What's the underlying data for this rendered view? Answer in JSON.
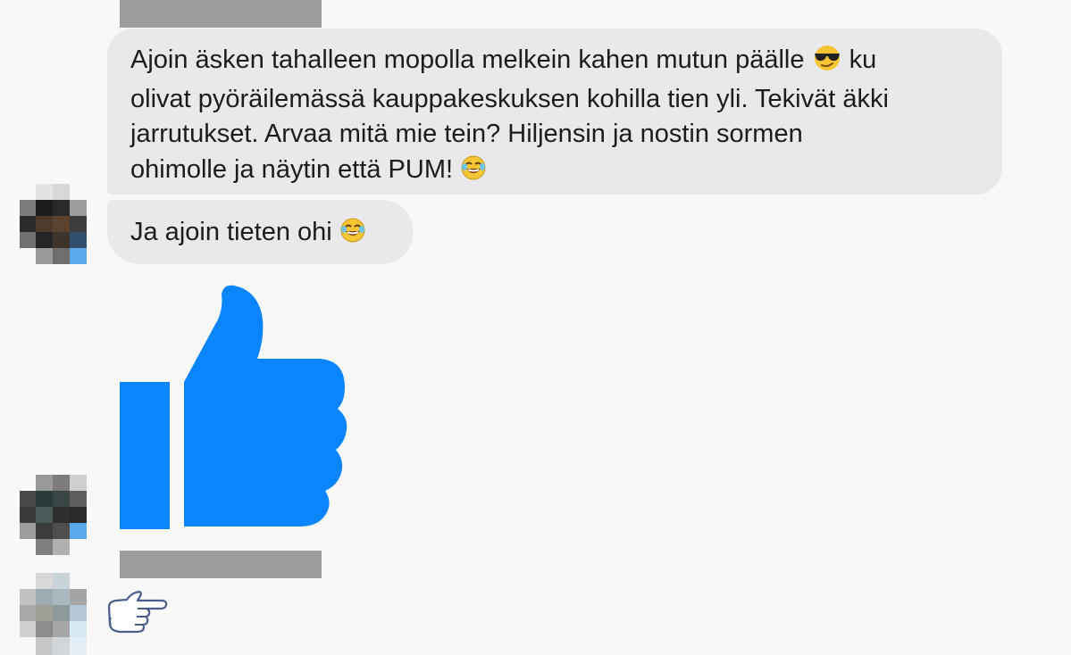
{
  "messages": [
    {
      "lines": [
        {
          "text": "Ajoin äsken tahalleen mopolla melkein kahen mutun päälle",
          "emoji": "sunglasses-face-emoji",
          "after": "ku"
        },
        {
          "text": "olivat pyöräilemässä kauppakeskuksen kohilla tien yli. Tekivät äkki"
        },
        {
          "text": "jarrutukset. Arvaa mitä mie tein? Hiljensin ja nostin sormen"
        },
        {
          "text": "ohimolle ja näytin että PUM!",
          "emoji": "tears-of-joy-emoji"
        }
      ]
    },
    {
      "text": "Ja ajoin tieten ohi",
      "emoji": "tears-of-joy-emoji"
    }
  ],
  "reactions": {
    "thumbs_up": {
      "icon": "thumbs-up-icon",
      "color": "#0a84ff"
    },
    "pointing_hand": {
      "icon": "pointing-right-hand-icon"
    }
  },
  "colors": {
    "background": "#f8f8f8",
    "bubble": "#e9e9eb",
    "text": "#1c1c1c",
    "redaction": "#9b9b9b",
    "like_blue": "#0a84ff"
  }
}
